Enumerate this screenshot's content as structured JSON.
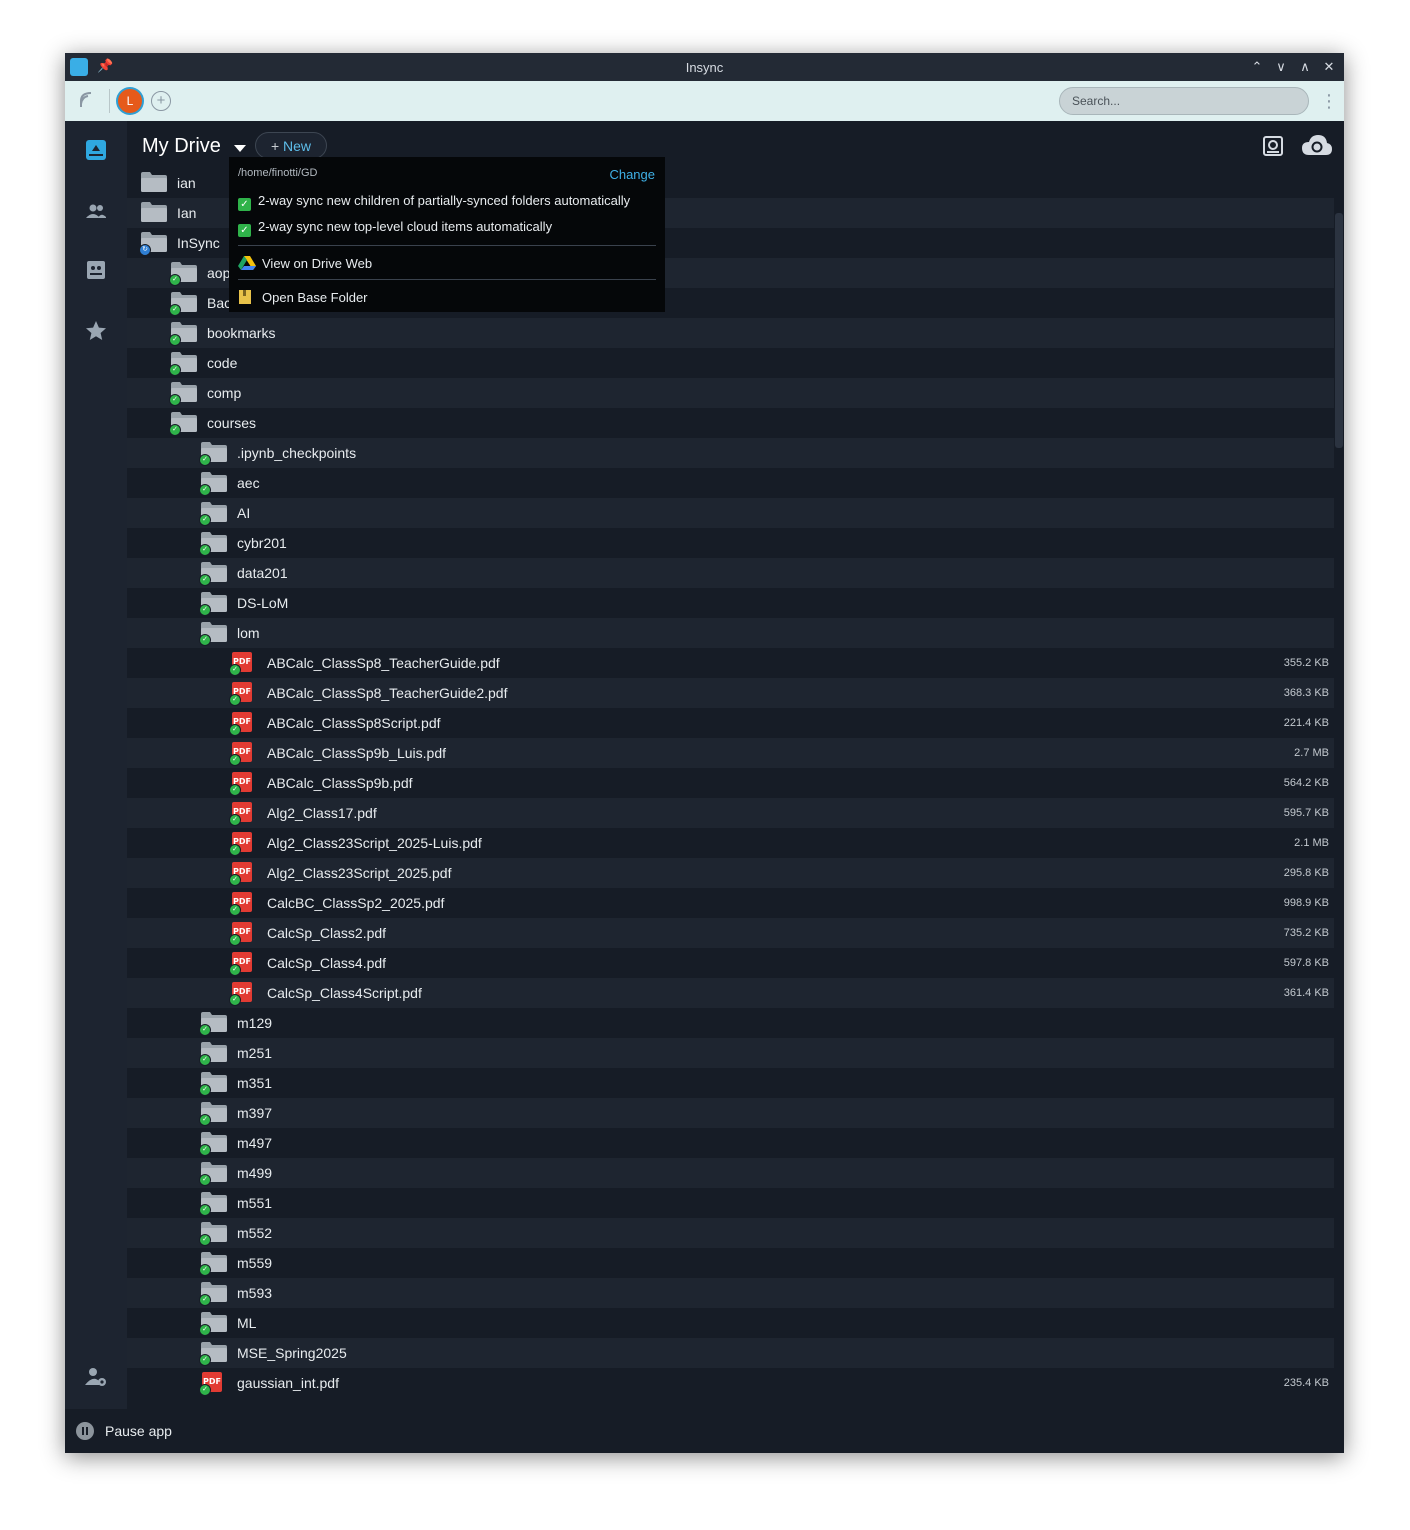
{
  "window": {
    "title": "Insync"
  },
  "toolbar": {
    "avatar_letter": "L",
    "search_placeholder": "Search..."
  },
  "header": {
    "drive_title": "My Drive",
    "new_label": "New"
  },
  "popup": {
    "path": "/home/finotti/GD",
    "change_label": "Change",
    "option1": "2-way sync new children of partially-synced folders automatically",
    "option2": "2-way sync new top-level cloud items automatically",
    "view_web": "View on Drive Web",
    "open_base": "Open Base Folder"
  },
  "files": [
    {
      "name": "ian",
      "type": "folder",
      "level": 0,
      "size": "",
      "badge": "none"
    },
    {
      "name": "Ian",
      "type": "folder",
      "level": 0,
      "size": "",
      "badge": "none"
    },
    {
      "name": "InSync",
      "type": "folder",
      "level": 0,
      "size": "",
      "badge": "sync"
    },
    {
      "name": "aop",
      "type": "folder",
      "level": 1,
      "size": "",
      "badge": "ok"
    },
    {
      "name": "Bac",
      "type": "folder",
      "level": 1,
      "size": "",
      "badge": "ok"
    },
    {
      "name": "bookmarks",
      "type": "folder",
      "level": 1,
      "size": "",
      "badge": "ok"
    },
    {
      "name": "code",
      "type": "folder",
      "level": 1,
      "size": "",
      "badge": "ok"
    },
    {
      "name": "comp",
      "type": "folder",
      "level": 1,
      "size": "",
      "badge": "ok"
    },
    {
      "name": "courses",
      "type": "folder",
      "level": 1,
      "size": "",
      "badge": "ok"
    },
    {
      "name": ".ipynb_checkpoints",
      "type": "folder",
      "level": 2,
      "size": "",
      "badge": "ok"
    },
    {
      "name": "aec",
      "type": "folder",
      "level": 2,
      "size": "",
      "badge": "ok"
    },
    {
      "name": "AI",
      "type": "folder",
      "level": 2,
      "size": "",
      "badge": "ok"
    },
    {
      "name": "cybr201",
      "type": "folder",
      "level": 2,
      "size": "",
      "badge": "ok"
    },
    {
      "name": "data201",
      "type": "folder",
      "level": 2,
      "size": "",
      "badge": "ok"
    },
    {
      "name": "DS-LoM",
      "type": "folder",
      "level": 2,
      "size": "",
      "badge": "ok"
    },
    {
      "name": "lom",
      "type": "folder",
      "level": 2,
      "size": "",
      "badge": "ok"
    },
    {
      "name": "ABCalc_ClassSp8_TeacherGuide.pdf",
      "type": "pdf",
      "level": 3,
      "size": "355.2 KB",
      "badge": "ok"
    },
    {
      "name": "ABCalc_ClassSp8_TeacherGuide2.pdf",
      "type": "pdf",
      "level": 3,
      "size": "368.3 KB",
      "badge": "ok"
    },
    {
      "name": "ABCalc_ClassSp8Script.pdf",
      "type": "pdf",
      "level": 3,
      "size": "221.4 KB",
      "badge": "ok"
    },
    {
      "name": "ABCalc_ClassSp9b_Luis.pdf",
      "type": "pdf",
      "level": 3,
      "size": "2.7 MB",
      "badge": "ok"
    },
    {
      "name": "ABCalc_ClassSp9b.pdf",
      "type": "pdf",
      "level": 3,
      "size": "564.2 KB",
      "badge": "ok"
    },
    {
      "name": "Alg2_Class17.pdf",
      "type": "pdf",
      "level": 3,
      "size": "595.7 KB",
      "badge": "ok"
    },
    {
      "name": "Alg2_Class23Script_2025-Luis.pdf",
      "type": "pdf",
      "level": 3,
      "size": "2.1 MB",
      "badge": "ok"
    },
    {
      "name": "Alg2_Class23Script_2025.pdf",
      "type": "pdf",
      "level": 3,
      "size": "295.8 KB",
      "badge": "ok"
    },
    {
      "name": "CalcBC_ClassSp2_2025.pdf",
      "type": "pdf",
      "level": 3,
      "size": "998.9 KB",
      "badge": "ok"
    },
    {
      "name": "CalcSp_Class2.pdf",
      "type": "pdf",
      "level": 3,
      "size": "735.2 KB",
      "badge": "ok"
    },
    {
      "name": "CalcSp_Class4.pdf",
      "type": "pdf",
      "level": 3,
      "size": "597.8 KB",
      "badge": "ok"
    },
    {
      "name": "CalcSp_Class4Script.pdf",
      "type": "pdf",
      "level": 3,
      "size": "361.4 KB",
      "badge": "ok"
    },
    {
      "name": "m129",
      "type": "folder",
      "level": 2,
      "size": "",
      "badge": "ok"
    },
    {
      "name": "m251",
      "type": "folder",
      "level": 2,
      "size": "",
      "badge": "ok"
    },
    {
      "name": "m351",
      "type": "folder",
      "level": 2,
      "size": "",
      "badge": "ok"
    },
    {
      "name": "m397",
      "type": "folder",
      "level": 2,
      "size": "",
      "badge": "ok"
    },
    {
      "name": "m497",
      "type": "folder",
      "level": 2,
      "size": "",
      "badge": "ok"
    },
    {
      "name": "m499",
      "type": "folder",
      "level": 2,
      "size": "",
      "badge": "ok"
    },
    {
      "name": "m551",
      "type": "folder",
      "level": 2,
      "size": "",
      "badge": "ok"
    },
    {
      "name": "m552",
      "type": "folder",
      "level": 2,
      "size": "",
      "badge": "ok"
    },
    {
      "name": "m559",
      "type": "folder",
      "level": 2,
      "size": "",
      "badge": "ok"
    },
    {
      "name": "m593",
      "type": "folder",
      "level": 2,
      "size": "",
      "badge": "ok"
    },
    {
      "name": "ML",
      "type": "folder",
      "level": 2,
      "size": "",
      "badge": "ok"
    },
    {
      "name": "MSE_Spring2025",
      "type": "folder",
      "level": 2,
      "size": "",
      "badge": "ok"
    },
    {
      "name": "gaussian_int.pdf",
      "type": "pdf",
      "level": 2,
      "size": "235.4 KB",
      "badge": "ok"
    }
  ],
  "status": {
    "pause_label": "Pause app"
  },
  "colors": {
    "accent": "#3fb0e6",
    "sync_ok": "#2fb34a",
    "background": "#161c26"
  }
}
